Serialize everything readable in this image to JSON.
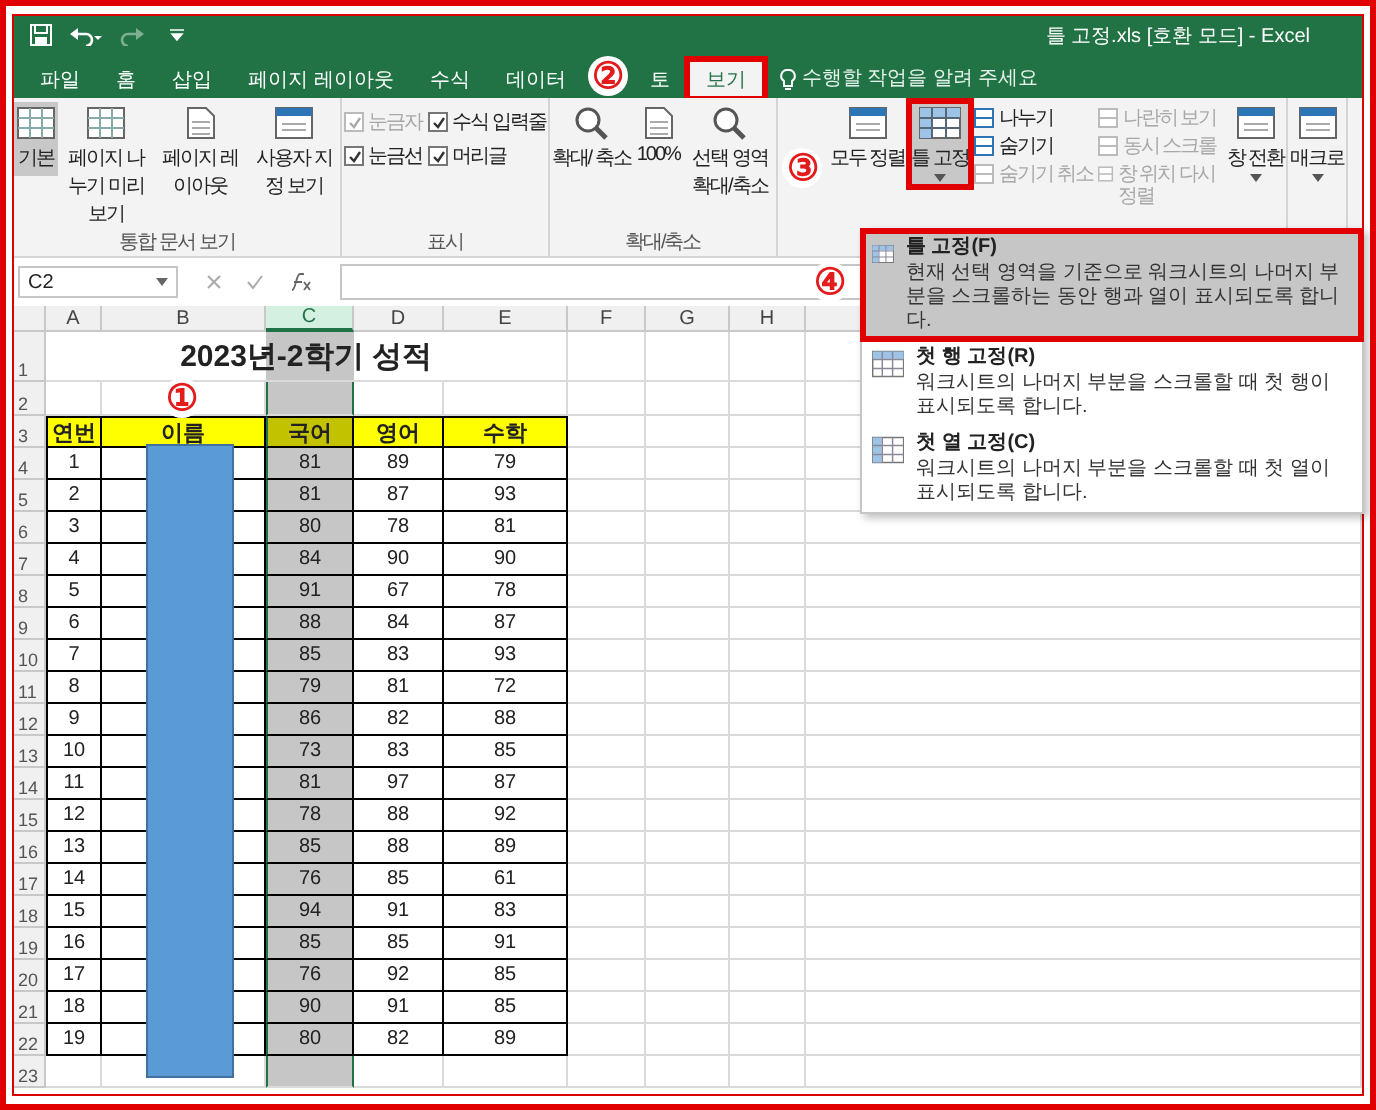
{
  "window": {
    "title": "틀 고정.xls [호환 모드] - Excel"
  },
  "tabs": [
    {
      "label": "파일",
      "selected": false,
      "highlighted": false
    },
    {
      "label": "홈",
      "selected": false,
      "highlighted": false
    },
    {
      "label": "삽입",
      "selected": false,
      "highlighted": false
    },
    {
      "label": "페이지 레이아웃",
      "selected": false,
      "highlighted": false
    },
    {
      "label": "수식",
      "selected": false,
      "highlighted": false
    },
    {
      "label": "데이터",
      "selected": false,
      "highlighted": false
    },
    {
      "label": "토",
      "selected": false,
      "highlighted": false
    },
    {
      "label": "보기",
      "selected": true,
      "highlighted": true
    }
  ],
  "tell_me": {
    "placeholder": "수행할 작업을 알려 주세요"
  },
  "ribbon": {
    "groups": [
      {
        "label": "통합 문서 보기",
        "items": [
          {
            "kind": "large",
            "label": "기본",
            "selected": true,
            "highlighted": false,
            "dropdown": false
          },
          {
            "kind": "large",
            "label": "페이지 나누기 미리 보기",
            "selected": false,
            "highlighted": false,
            "dropdown": false
          },
          {
            "kind": "large",
            "label": "페이지 레이아웃",
            "selected": false,
            "highlighted": false,
            "dropdown": false
          },
          {
            "kind": "large",
            "label": "사용자 지정 보기",
            "selected": false,
            "highlighted": false,
            "dropdown": false
          }
        ]
      },
      {
        "label": "표시",
        "items": [
          {
            "kind": "check",
            "label": "눈금자",
            "checked": true,
            "disabled": true
          },
          {
            "kind": "check",
            "label": "눈금선",
            "checked": true,
            "disabled": false
          },
          {
            "kind": "check",
            "label": "수식 입력줄",
            "checked": true,
            "disabled": false
          },
          {
            "kind": "check",
            "label": "머리글",
            "checked": true,
            "disabled": false
          }
        ]
      },
      {
        "label": "확대/축소",
        "items": [
          {
            "kind": "large",
            "label": "확대/ 축소",
            "selected": false,
            "highlighted": false,
            "dropdown": false
          },
          {
            "kind": "large",
            "label": "100%",
            "selected": false,
            "highlighted": false,
            "dropdown": false
          },
          {
            "kind": "large",
            "label": "선택 영역 확대/축소",
            "selected": false,
            "highlighted": false,
            "dropdown": false
          }
        ]
      },
      {
        "items": [
          {
            "kind": "large",
            "label": "모두 정렬",
            "selected": false,
            "highlighted": false,
            "dropdown": false
          },
          {
            "kind": "large",
            "label": "틀 고정",
            "selected": true,
            "highlighted": true,
            "dropdown": true
          },
          {
            "kind": "small",
            "label": "나누기",
            "disabled": false
          },
          {
            "kind": "small",
            "label": "숨기기",
            "disabled": false
          },
          {
            "kind": "small",
            "label": "숨기기 취소",
            "disabled": true
          },
          {
            "kind": "small",
            "label": "나란히 보기",
            "disabled": true
          },
          {
            "kind": "small",
            "label": "동시 스크롤",
            "disabled": true
          },
          {
            "kind": "small",
            "label": "창 위치 다시 정렬",
            "disabled": true
          },
          {
            "kind": "large",
            "label": "창 전환",
            "selected": false,
            "highlighted": false,
            "dropdown": true
          }
        ]
      },
      {
        "items": [
          {
            "kind": "large",
            "label": "매크로",
            "selected": false,
            "highlighted": false,
            "dropdown": true
          }
        ]
      }
    ]
  },
  "name_box": {
    "value": "C2"
  },
  "menu": {
    "items": [
      {
        "label": "틀 고정(F)",
        "description": "현재 선택 영역을 기준으로 워크시트의 나머지 부분을 스크롤하는 동안 행과 열이 표시되도록 합니다.",
        "selected": true,
        "highlighted": true
      },
      {
        "label": "첫 행 고정(R)",
        "description": "워크시트의 나머지 부분을 스크롤할 때 첫 행이 표시되도록 합니다.",
        "selected": false,
        "highlighted": false
      },
      {
        "label": "첫 열 고정(C)",
        "description": "워크시트의 나머지 부분을 스크롤할 때 첫 열이 표시되도록 합니다.",
        "selected": false,
        "highlighted": false
      }
    ]
  },
  "sheet": {
    "columns": [
      {
        "label": "A",
        "selected": false
      },
      {
        "label": "B",
        "selected": false
      },
      {
        "label": "C",
        "selected": true
      },
      {
        "label": "D",
        "selected": false
      },
      {
        "label": "E",
        "selected": false
      },
      {
        "label": "F",
        "selected": false
      },
      {
        "label": "G",
        "selected": false
      },
      {
        "label": "H",
        "selected": false
      }
    ],
    "row_headers": [
      "1",
      "2",
      "3",
      "4",
      "5",
      "6",
      "7",
      "8",
      "9",
      "10",
      "11",
      "12",
      "13",
      "14",
      "15",
      "16",
      "17",
      "18",
      "19",
      "20",
      "21",
      "22",
      "23"
    ],
    "title": "2023년-2학기 성적",
    "header": [
      "연번",
      "이름",
      "국어",
      "영어",
      "수학"
    ],
    "rows": [
      [
        "1",
        "",
        "81",
        "89",
        "79"
      ],
      [
        "2",
        "",
        "81",
        "87",
        "93"
      ],
      [
        "3",
        "",
        "80",
        "78",
        "81"
      ],
      [
        "4",
        "",
        "84",
        "90",
        "90"
      ],
      [
        "5",
        "",
        "91",
        "67",
        "78"
      ],
      [
        "6",
        "",
        "88",
        "84",
        "87"
      ],
      [
        "7",
        "",
        "85",
        "83",
        "93"
      ],
      [
        "8",
        "",
        "79",
        "81",
        "72"
      ],
      [
        "9",
        "",
        "86",
        "82",
        "88"
      ],
      [
        "10",
        "",
        "73",
        "83",
        "85"
      ],
      [
        "11",
        "",
        "81",
        "97",
        "87"
      ],
      [
        "12",
        "",
        "78",
        "88",
        "92"
      ],
      [
        "13",
        "",
        "85",
        "88",
        "89"
      ],
      [
        "14",
        "",
        "76",
        "85",
        "61"
      ],
      [
        "15",
        "",
        "94",
        "91",
        "83"
      ],
      [
        "16",
        "",
        "85",
        "85",
        "91"
      ],
      [
        "17",
        "",
        "76",
        "92",
        "85"
      ],
      [
        "18",
        "",
        "90",
        "91",
        "85"
      ],
      [
        "19",
        "",
        "80",
        "82",
        "89"
      ]
    ]
  },
  "annotations": [
    {
      "label": "①"
    },
    {
      "label": "②"
    },
    {
      "label": "③"
    },
    {
      "label": "④"
    }
  ]
}
